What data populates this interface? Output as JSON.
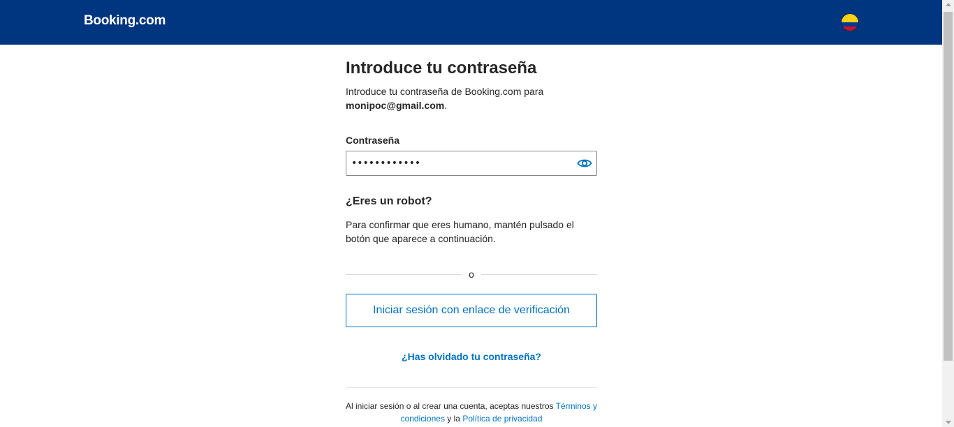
{
  "header": {
    "logo_text": "Booking.com",
    "brand_color": "#003580",
    "flag": "colombia-flag-icon"
  },
  "signin": {
    "title": "Introduce tu contraseña",
    "intro": "Introduce tu contraseña de Booking.com para",
    "email": "monipoc@gmail.com",
    "email_suffix": ".",
    "password_label": "Contraseña",
    "password_value": "••••••••••••",
    "toggle_icon": "eye-icon"
  },
  "robot": {
    "title": "¿Eres un robot?",
    "text": "Para confirmar que eres humano, mantén pulsado el botón que aparece a continuación."
  },
  "divider_text": "o",
  "buttons": {
    "verify_link": "Iniciar sesión con enlace de verificación",
    "forgot_password": "¿Has olvidado tu contraseña?"
  },
  "legal": {
    "prefix": "Al iniciar sesión o al crear una cuenta, aceptas nuestros",
    "terms": "Términos y condiciones",
    "conjunction": "y la",
    "privacy": "Política de privacidad"
  },
  "colors": {
    "link": "#0071c2",
    "text": "#262626"
  }
}
